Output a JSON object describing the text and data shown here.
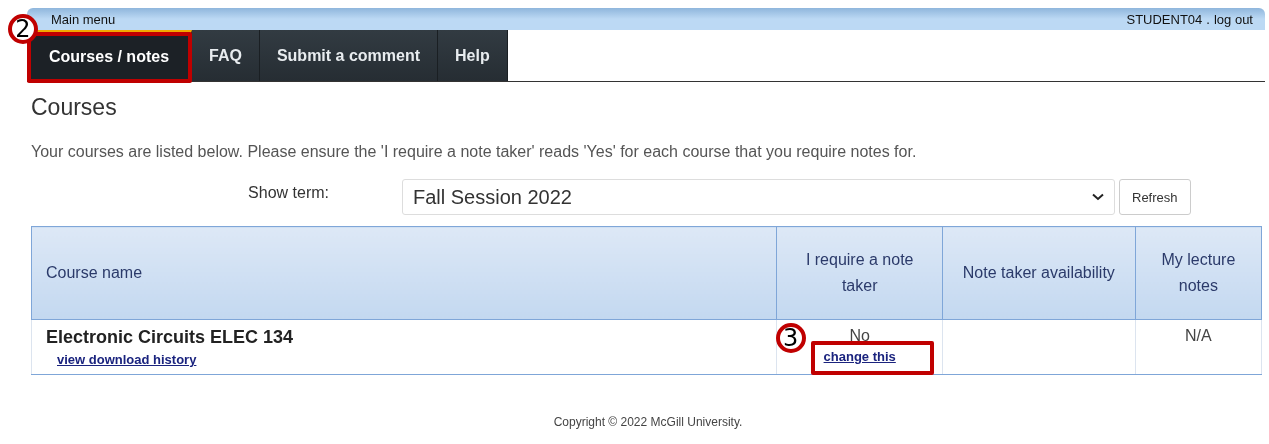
{
  "top_bar": {
    "title": "Main menu",
    "user": "STUDENT04",
    "logout": "log out",
    "separator": "."
  },
  "tabs": [
    {
      "label": "Courses / notes",
      "selected": true,
      "callout": "2"
    },
    {
      "label": "FAQ",
      "selected": false
    },
    {
      "label": "Submit a comment",
      "selected": false
    },
    {
      "label": "Help",
      "selected": false
    }
  ],
  "heading": "Courses",
  "intro": "Your courses are listed below. Please ensure the 'I require a note taker' reads 'Yes' for each course that you require notes for.",
  "term": {
    "label": "Show term:",
    "value": "Fall Session 2022",
    "button": "Refresh"
  },
  "table": {
    "columns": [
      "Course name",
      "I require a note taker",
      "Note taker availability",
      "My lecture notes"
    ],
    "rows": [
      {
        "course": "Electronic Circuits ELEC 134",
        "history_link": "view download history",
        "require": "No",
        "change_link": "change this",
        "change_callout": "3",
        "availability": "",
        "notes": "N/A"
      }
    ]
  },
  "footer": "Copyright © 2022 McGill University."
}
